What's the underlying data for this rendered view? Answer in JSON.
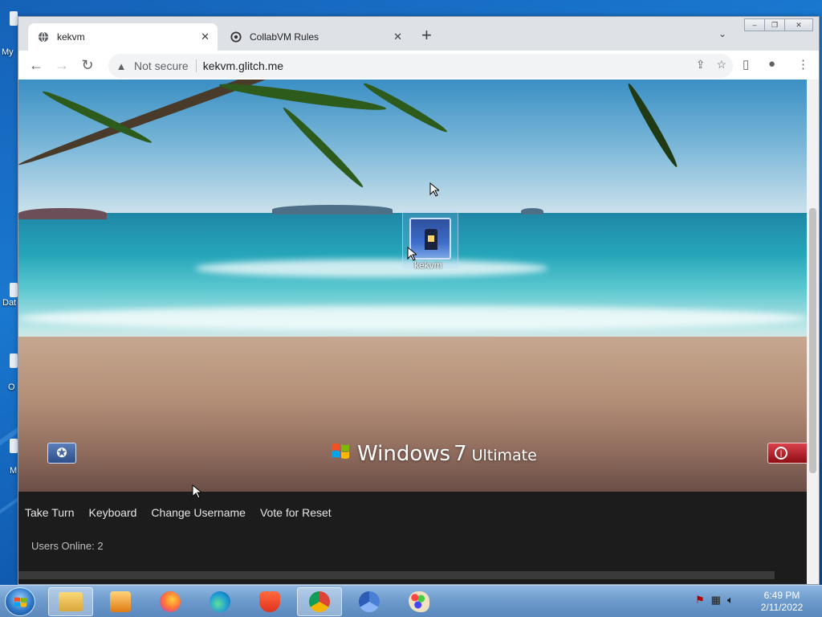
{
  "host": {
    "desktop_peek_labels": [
      "My",
      "Dat",
      "O",
      "M"
    ]
  },
  "browser": {
    "tabs": [
      {
        "title": "kekvm",
        "active": true,
        "icon": "globe-icon"
      },
      {
        "title": "CollabVM Rules",
        "active": false,
        "icon": "collabvm-icon"
      }
    ],
    "omnibox": {
      "security_label": "Not secure",
      "url": "kekvm.glitch.me"
    }
  },
  "vm": {
    "desktop_icon_label": "kekvm",
    "branding": {
      "windows": "Windows",
      "version": "7",
      "edition": "Ultimate"
    },
    "controls": [
      {
        "label": "Take Turn"
      },
      {
        "label": "Keyboard"
      },
      {
        "label": "Change Username"
      },
      {
        "label": "Vote for Reset"
      }
    ],
    "users_online": "Users Online: 2"
  },
  "taskbar": {
    "apps": [
      {
        "name": "explorer-icon",
        "active": true
      },
      {
        "name": "media-player-icon",
        "active": false
      },
      {
        "name": "firefox-icon",
        "active": false
      },
      {
        "name": "edge-icon",
        "active": false
      },
      {
        "name": "brave-icon",
        "active": false
      },
      {
        "name": "chrome-icon",
        "active": true
      },
      {
        "name": "chromium-icon",
        "active": false
      },
      {
        "name": "paint-icon",
        "active": false
      }
    ],
    "clock": {
      "time": "6:49 PM",
      "date": "2/11/2022"
    }
  }
}
